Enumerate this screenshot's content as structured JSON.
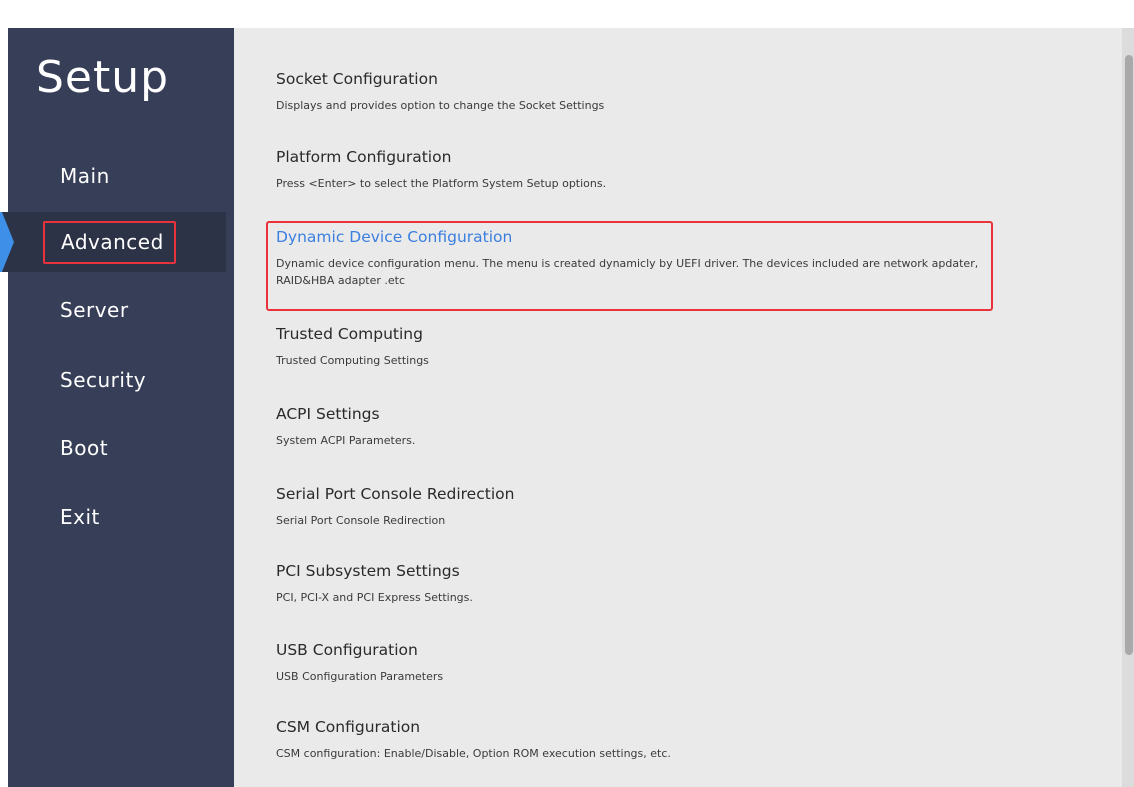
{
  "sidebar": {
    "title": "Setup",
    "items": [
      {
        "label": "Main",
        "active": false
      },
      {
        "label": "Advanced",
        "active": true
      },
      {
        "label": "Server",
        "active": false
      },
      {
        "label": "Security",
        "active": false
      },
      {
        "label": "Boot",
        "active": false
      },
      {
        "label": "Exit",
        "active": false
      }
    ]
  },
  "menu": [
    {
      "title": "Socket Configuration",
      "description": "Displays and provides option to change the Socket Settings"
    },
    {
      "title": "Platform Configuration",
      "description": "Press <Enter> to select the Platform System Setup options."
    },
    {
      "title": "Dynamic Device Configuration",
      "description": "Dynamic device configuration menu. The menu is created dynamicly by UEFI driver. The devices included are network apdater, RAID&HBA adapter .etc"
    },
    {
      "title": "Trusted Computing",
      "description": "Trusted Computing Settings"
    },
    {
      "title": "ACPI Settings",
      "description": "System ACPI Parameters."
    },
    {
      "title": "Serial Port Console Redirection",
      "description": "Serial Port Console Redirection"
    },
    {
      "title": "PCI Subsystem Settings",
      "description": "PCI, PCI-X and PCI Express Settings."
    },
    {
      "title": "USB Configuration",
      "description": "USB Configuration Parameters"
    },
    {
      "title": "CSM Configuration",
      "description": "CSM configuration: Enable/Disable, Option ROM execution settings, etc."
    }
  ],
  "colors": {
    "sidebar_bg": "#373f58",
    "active_accent": "#3d8fe8",
    "highlight_title": "#3a7fe0",
    "annotation_red": "#e8323c"
  }
}
